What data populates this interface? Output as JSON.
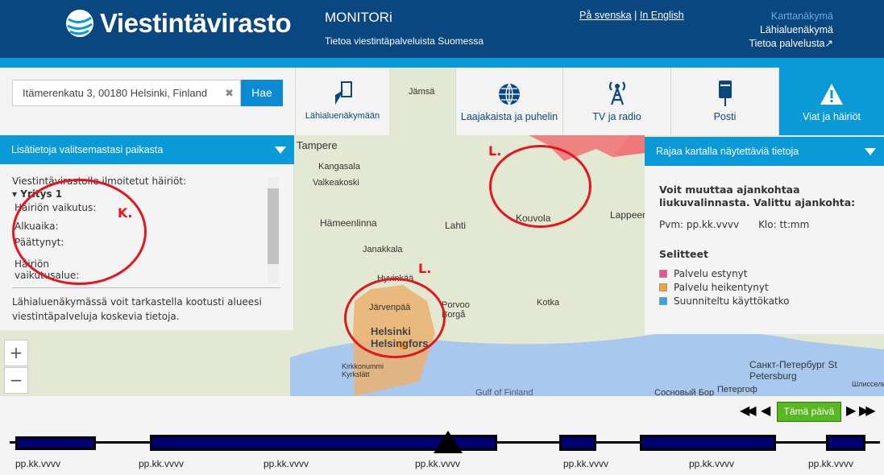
{
  "header": {
    "logo_text": "Viestintävirasto",
    "app_title": "MONITORi",
    "tagline": "Tietoa viestintäpalveluista Suomessa",
    "lang_sv": "På svenska",
    "lang_sep": "|",
    "lang_en": "In English",
    "views": [
      "Karttanäkymä",
      "Lähialuenäkymä",
      "Tietoa palvelusta"
    ],
    "link_active_color": "#6fa8dc"
  },
  "search": {
    "value": "Itämerenkatu 3, 00180 Helsinki, Finland",
    "clear": "✖",
    "button": "Hae"
  },
  "tabs": [
    {
      "label": "Lähialuenäkymään",
      "icon": "pointer-icon"
    },
    {
      "label": "Laajakaista ja puhelin",
      "icon": "globe-icon"
    },
    {
      "label": "TV ja radio",
      "icon": "antenna-icon"
    },
    {
      "label": "Posti",
      "icon": "mailbox-icon"
    },
    {
      "label": "Viat ja häiriöt",
      "icon": "warning-icon",
      "active": true
    }
  ],
  "left_panel": {
    "title": "Lisätietoja valitsemastasi paikasta",
    "heading": "Viestintävirastolle ilmoitetut häiriöt:",
    "company": "Yritys 1",
    "fields": [
      "Häiriön vaikutus:",
      "Alkuaika:",
      "Päättynyt:",
      "Häiriön vaikutusalue:"
    ],
    "footer": "Lähialuenäkymässä voit tarkastella kootusti alueesi viestintäpalveluja koskevia tietoja."
  },
  "right_panel": {
    "title": "Rajaa kartalla näytettäviä tietoja",
    "intro": "Voit muuttaa ajankohtaa liukuvalinnasta. Valittu ajankohta:",
    "date": "Pvm: pp.kk.vvvv",
    "time": "Klo: tt:mm",
    "legend_title": "Selitteet",
    "legend": [
      {
        "label": "Palvelu estynyt",
        "color": "#f04e98"
      },
      {
        "label": "Palvelu heikentynyt",
        "color": "#f8a32b"
      },
      {
        "label": "Suunniteltu käyttökatko",
        "color": "#2ea8e0"
      }
    ]
  },
  "annotations": {
    "k": "K.",
    "l1": "L.",
    "l2": "L."
  },
  "map": {
    "labels": [
      "Jämsä",
      "Tampere",
      "Kangasala",
      "Valkeakoski",
      "Hämeenlinna",
      "Janakkala",
      "Lahti",
      "Kouvola",
      "Lappeenranta",
      "Hyvinkää",
      "Järvenpää",
      "Porvoo Borgå",
      "Kotka",
      "Helsinki Helsingfors",
      "Kirkkonummi Kyrkslätt",
      "Gulf of Finland",
      "Санкт-Петербург St Petersburg",
      "Сосновый Бор",
      "Петергоф",
      "Шлиссельбург"
    ],
    "zoom_in": "+",
    "zoom_out": "−"
  },
  "timeline": {
    "today": "Tämä päivä",
    "dates": [
      "pp.kk.vvvv",
      "pp.kk.vvvv",
      "pp.kk.vvvv",
      "pp.kk.vvvv",
      "pp.kk.vvvv",
      "pp.kk.vvvv",
      "pp.kk.vvvv"
    ]
  }
}
